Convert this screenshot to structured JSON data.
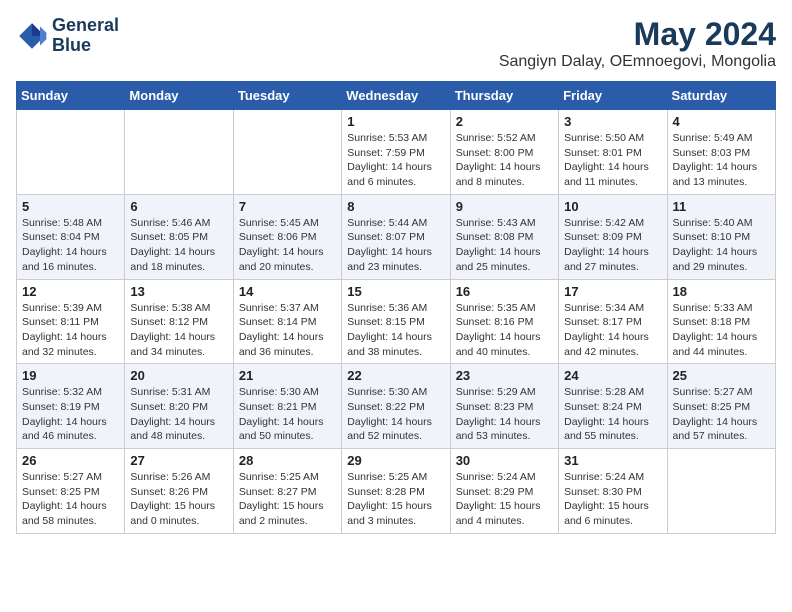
{
  "logo": {
    "line1": "General",
    "line2": "Blue"
  },
  "title": "May 2024",
  "location": "Sangiyn Dalay, OEmnoegovi, Mongolia",
  "weekdays": [
    "Sunday",
    "Monday",
    "Tuesday",
    "Wednesday",
    "Thursday",
    "Friday",
    "Saturday"
  ],
  "weeks": [
    [
      {
        "day": "",
        "sunrise": "",
        "sunset": "",
        "daylight": ""
      },
      {
        "day": "",
        "sunrise": "",
        "sunset": "",
        "daylight": ""
      },
      {
        "day": "",
        "sunrise": "",
        "sunset": "",
        "daylight": ""
      },
      {
        "day": "1",
        "sunrise": "Sunrise: 5:53 AM",
        "sunset": "Sunset: 7:59 PM",
        "daylight": "Daylight: 14 hours and 6 minutes."
      },
      {
        "day": "2",
        "sunrise": "Sunrise: 5:52 AM",
        "sunset": "Sunset: 8:00 PM",
        "daylight": "Daylight: 14 hours and 8 minutes."
      },
      {
        "day": "3",
        "sunrise": "Sunrise: 5:50 AM",
        "sunset": "Sunset: 8:01 PM",
        "daylight": "Daylight: 14 hours and 11 minutes."
      },
      {
        "day": "4",
        "sunrise": "Sunrise: 5:49 AM",
        "sunset": "Sunset: 8:03 PM",
        "daylight": "Daylight: 14 hours and 13 minutes."
      }
    ],
    [
      {
        "day": "5",
        "sunrise": "Sunrise: 5:48 AM",
        "sunset": "Sunset: 8:04 PM",
        "daylight": "Daylight: 14 hours and 16 minutes."
      },
      {
        "day": "6",
        "sunrise": "Sunrise: 5:46 AM",
        "sunset": "Sunset: 8:05 PM",
        "daylight": "Daylight: 14 hours and 18 minutes."
      },
      {
        "day": "7",
        "sunrise": "Sunrise: 5:45 AM",
        "sunset": "Sunset: 8:06 PM",
        "daylight": "Daylight: 14 hours and 20 minutes."
      },
      {
        "day": "8",
        "sunrise": "Sunrise: 5:44 AM",
        "sunset": "Sunset: 8:07 PM",
        "daylight": "Daylight: 14 hours and 23 minutes."
      },
      {
        "day": "9",
        "sunrise": "Sunrise: 5:43 AM",
        "sunset": "Sunset: 8:08 PM",
        "daylight": "Daylight: 14 hours and 25 minutes."
      },
      {
        "day": "10",
        "sunrise": "Sunrise: 5:42 AM",
        "sunset": "Sunset: 8:09 PM",
        "daylight": "Daylight: 14 hours and 27 minutes."
      },
      {
        "day": "11",
        "sunrise": "Sunrise: 5:40 AM",
        "sunset": "Sunset: 8:10 PM",
        "daylight": "Daylight: 14 hours and 29 minutes."
      }
    ],
    [
      {
        "day": "12",
        "sunrise": "Sunrise: 5:39 AM",
        "sunset": "Sunset: 8:11 PM",
        "daylight": "Daylight: 14 hours and 32 minutes."
      },
      {
        "day": "13",
        "sunrise": "Sunrise: 5:38 AM",
        "sunset": "Sunset: 8:12 PM",
        "daylight": "Daylight: 14 hours and 34 minutes."
      },
      {
        "day": "14",
        "sunrise": "Sunrise: 5:37 AM",
        "sunset": "Sunset: 8:14 PM",
        "daylight": "Daylight: 14 hours and 36 minutes."
      },
      {
        "day": "15",
        "sunrise": "Sunrise: 5:36 AM",
        "sunset": "Sunset: 8:15 PM",
        "daylight": "Daylight: 14 hours and 38 minutes."
      },
      {
        "day": "16",
        "sunrise": "Sunrise: 5:35 AM",
        "sunset": "Sunset: 8:16 PM",
        "daylight": "Daylight: 14 hours and 40 minutes."
      },
      {
        "day": "17",
        "sunrise": "Sunrise: 5:34 AM",
        "sunset": "Sunset: 8:17 PM",
        "daylight": "Daylight: 14 hours and 42 minutes."
      },
      {
        "day": "18",
        "sunrise": "Sunrise: 5:33 AM",
        "sunset": "Sunset: 8:18 PM",
        "daylight": "Daylight: 14 hours and 44 minutes."
      }
    ],
    [
      {
        "day": "19",
        "sunrise": "Sunrise: 5:32 AM",
        "sunset": "Sunset: 8:19 PM",
        "daylight": "Daylight: 14 hours and 46 minutes."
      },
      {
        "day": "20",
        "sunrise": "Sunrise: 5:31 AM",
        "sunset": "Sunset: 8:20 PM",
        "daylight": "Daylight: 14 hours and 48 minutes."
      },
      {
        "day": "21",
        "sunrise": "Sunrise: 5:30 AM",
        "sunset": "Sunset: 8:21 PM",
        "daylight": "Daylight: 14 hours and 50 minutes."
      },
      {
        "day": "22",
        "sunrise": "Sunrise: 5:30 AM",
        "sunset": "Sunset: 8:22 PM",
        "daylight": "Daylight: 14 hours and 52 minutes."
      },
      {
        "day": "23",
        "sunrise": "Sunrise: 5:29 AM",
        "sunset": "Sunset: 8:23 PM",
        "daylight": "Daylight: 14 hours and 53 minutes."
      },
      {
        "day": "24",
        "sunrise": "Sunrise: 5:28 AM",
        "sunset": "Sunset: 8:24 PM",
        "daylight": "Daylight: 14 hours and 55 minutes."
      },
      {
        "day": "25",
        "sunrise": "Sunrise: 5:27 AM",
        "sunset": "Sunset: 8:25 PM",
        "daylight": "Daylight: 14 hours and 57 minutes."
      }
    ],
    [
      {
        "day": "26",
        "sunrise": "Sunrise: 5:27 AM",
        "sunset": "Sunset: 8:25 PM",
        "daylight": "Daylight: 14 hours and 58 minutes."
      },
      {
        "day": "27",
        "sunrise": "Sunrise: 5:26 AM",
        "sunset": "Sunset: 8:26 PM",
        "daylight": "Daylight: 15 hours and 0 minutes."
      },
      {
        "day": "28",
        "sunrise": "Sunrise: 5:25 AM",
        "sunset": "Sunset: 8:27 PM",
        "daylight": "Daylight: 15 hours and 2 minutes."
      },
      {
        "day": "29",
        "sunrise": "Sunrise: 5:25 AM",
        "sunset": "Sunset: 8:28 PM",
        "daylight": "Daylight: 15 hours and 3 minutes."
      },
      {
        "day": "30",
        "sunrise": "Sunrise: 5:24 AM",
        "sunset": "Sunset: 8:29 PM",
        "daylight": "Daylight: 15 hours and 4 minutes."
      },
      {
        "day": "31",
        "sunrise": "Sunrise: 5:24 AM",
        "sunset": "Sunset: 8:30 PM",
        "daylight": "Daylight: 15 hours and 6 minutes."
      },
      {
        "day": "",
        "sunrise": "",
        "sunset": "",
        "daylight": ""
      }
    ]
  ]
}
